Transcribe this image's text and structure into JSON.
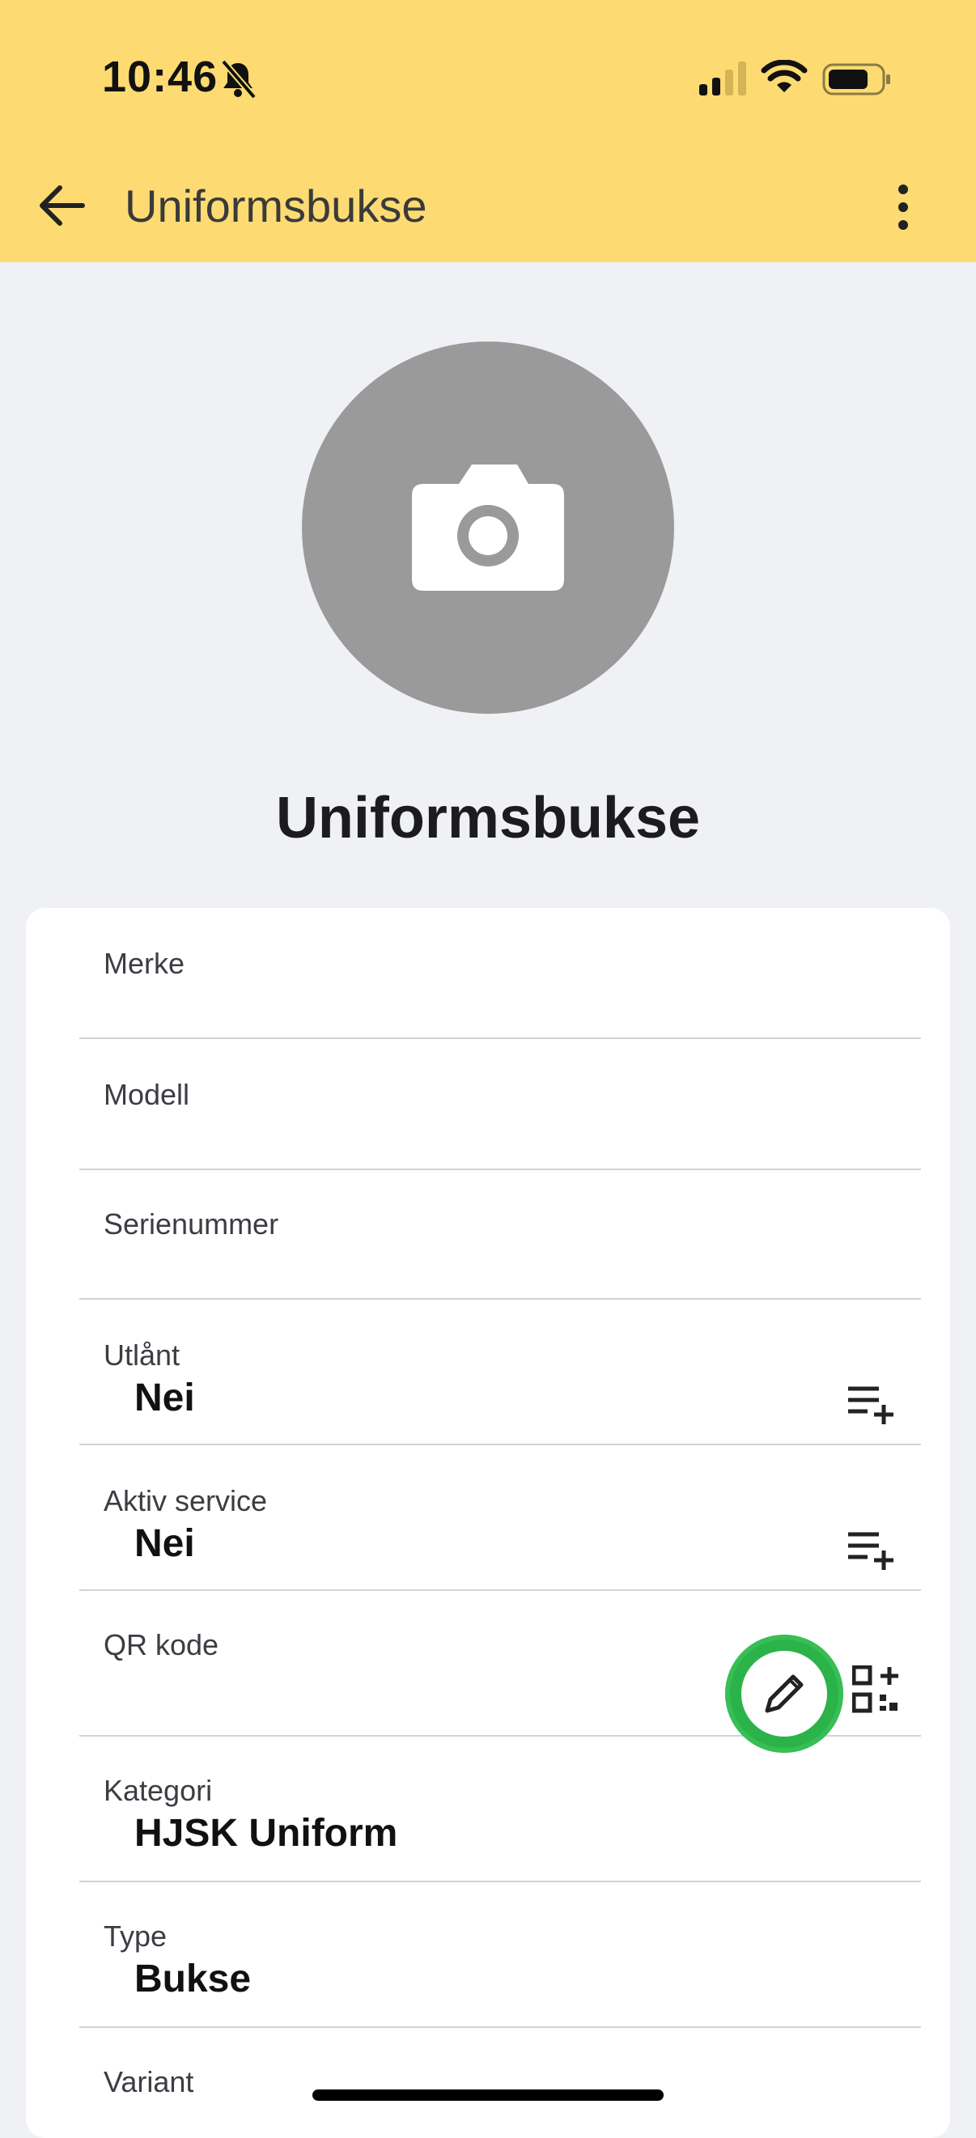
{
  "status_bar": {
    "time": "10:46",
    "silent_icon": "bell-slash-icon",
    "signal_icon": "signal-icon",
    "wifi_icon": "wifi-icon",
    "battery_icon": "battery-icon"
  },
  "app_bar": {
    "title": "Uniformsbukse",
    "back_icon": "arrow-left-icon",
    "menu_icon": "more-vertical-icon",
    "background": "#fddb72"
  },
  "item": {
    "photo_icon": "camera-icon",
    "name": "Uniformsbukse"
  },
  "fields": [
    {
      "label": "Merke",
      "value": ""
    },
    {
      "label": "Modell",
      "value": ""
    },
    {
      "label": "Serienummer",
      "value": ""
    },
    {
      "label": "Utlånt",
      "value": "Nei",
      "action_icon": "playlist-add-icon"
    },
    {
      "label": "Aktiv service",
      "value": "Nei",
      "action_icon": "playlist-add-icon"
    },
    {
      "label": "QR kode",
      "value": "",
      "action_icon": "qr-code-add-icon",
      "edit_icon": "pencil-icon"
    },
    {
      "label": "Kategori",
      "value": "HJSK Uniform"
    },
    {
      "label": "Type",
      "value": "Bukse"
    },
    {
      "label": "Variant",
      "value": ""
    }
  ]
}
